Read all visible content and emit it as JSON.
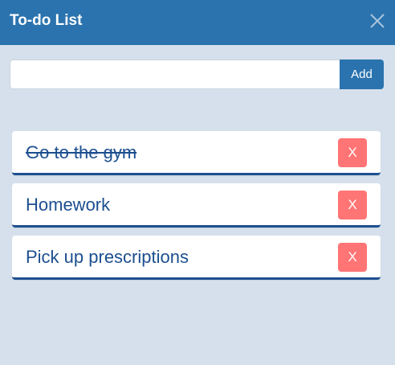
{
  "header": {
    "title": "To-do List",
    "close_icon": "close-icon"
  },
  "new_todo": {
    "value": "",
    "placeholder": "",
    "add_label": "Add"
  },
  "todos": [
    {
      "text": "Go to the gym",
      "completed": true,
      "delete_label": "X"
    },
    {
      "text": "Homework",
      "completed": false,
      "delete_label": "X"
    },
    {
      "text": "Pick up prescriptions",
      "completed": false,
      "delete_label": "X"
    }
  ],
  "colors": {
    "header_bg": "#2a73ae",
    "page_bg": "#d5e0ec",
    "text": "#1c4f8f",
    "delete_bg": "#ff7474"
  }
}
